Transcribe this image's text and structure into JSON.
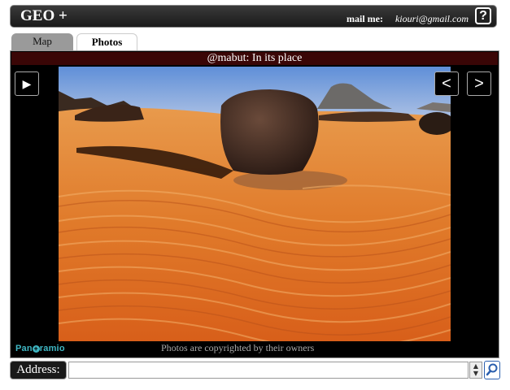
{
  "header": {
    "app_title": "GEO +",
    "mail_label": "mail me:",
    "mail_address": "kiouri@gmail.com",
    "help_glyph": "?"
  },
  "tabs": [
    {
      "label": "Map",
      "active": false
    },
    {
      "label": "Photos",
      "active": true
    }
  ],
  "photo": {
    "caption": "@mabut: In its place",
    "copyright": "Photos are copyrighted by their owners",
    "logo_text_1": "Pan",
    "logo_text_2": "ramio",
    "subject": "desert-boulder-on-sand-dunes"
  },
  "controls": {
    "play_glyph": "▶",
    "prev_glyph": "<",
    "next_glyph": ">"
  },
  "address": {
    "label": "Address:",
    "value": "",
    "placeholder": ""
  },
  "icons": [
    "help-icon",
    "play-icon",
    "prev-arrow-icon",
    "next-arrow-icon",
    "search-icon",
    "spinner-icon"
  ],
  "colors": {
    "header_bg": "#2a2a2a",
    "caption_bg": "#3a0606",
    "panel_bg": "#000000",
    "logo": "#3fb7c4",
    "search_accent": "#2b5fae"
  }
}
